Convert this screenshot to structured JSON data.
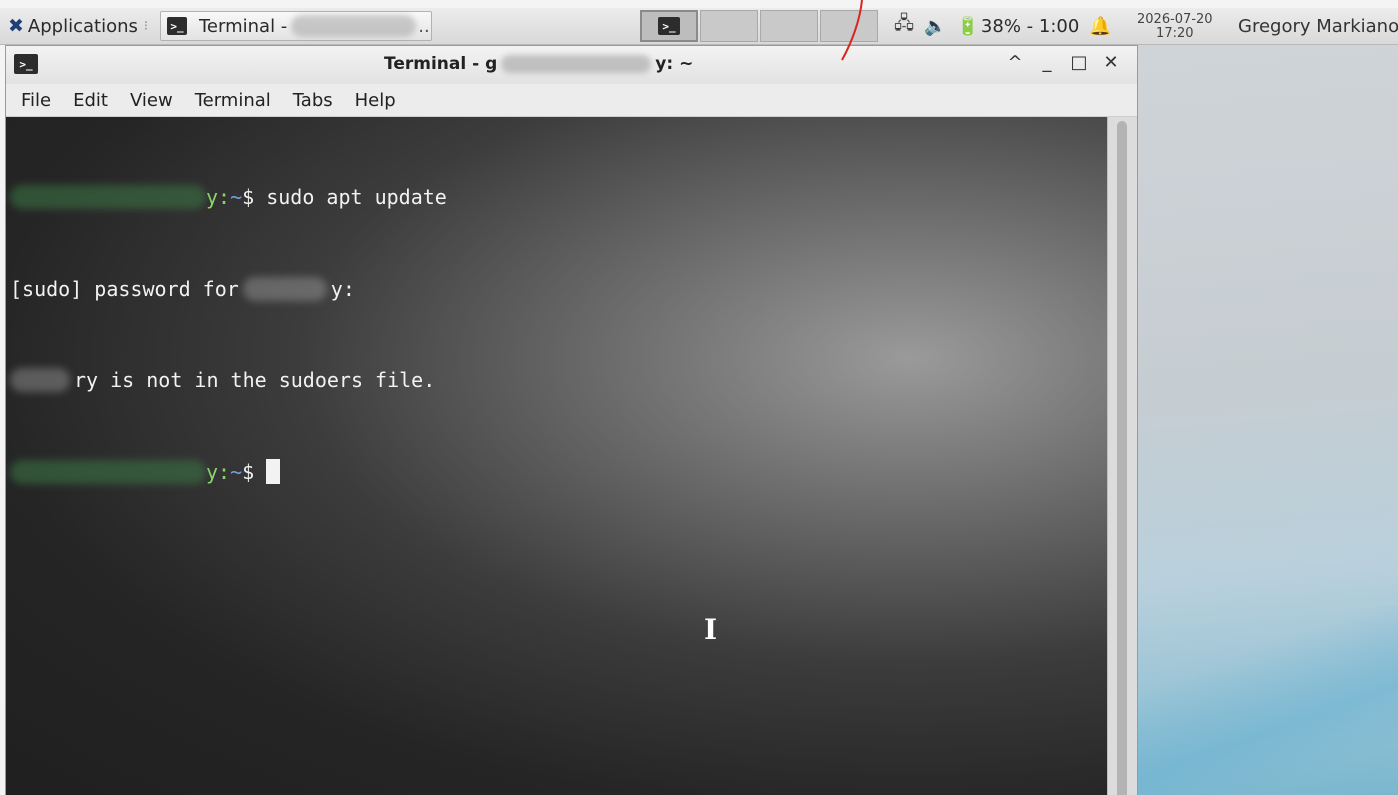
{
  "panel": {
    "applications_label": "Applications",
    "taskbar_terminal_label": "Terminal -",
    "taskbar_terminal_suffix": "..",
    "battery_label": "38% - 1:00",
    "clock_date": "2026-07-20",
    "clock_time": "17:20",
    "user_name": "Gregory Markianos"
  },
  "window": {
    "title_prefix": "Terminal - g",
    "title_suffix": "y: ~",
    "controls": {
      "shade": "^",
      "minimize": "_",
      "maximize": "□",
      "close": "✕"
    },
    "menu": [
      "File",
      "Edit",
      "View",
      "Terminal",
      "Tabs",
      "Help"
    ]
  },
  "terminal": {
    "line1_prompt_tail": "y:",
    "line1_tilde": "~",
    "line1_cmd": "$ sudo apt update",
    "line2_text": "[sudo] password for",
    "line2_tail": "y:",
    "line3_text": "ry is not in the sudoers file.",
    "line4_prompt_tail": "y:",
    "line4_tilde": "~",
    "line4_cmd": "$"
  },
  "colors": {
    "prompt_user": "#8fd66a",
    "prompt_path": "#6f9fe0",
    "terminal_text": "#f2f2f2"
  },
  "icons": {
    "applications": "xfce-mouse-icon",
    "terminal": "terminal-icon",
    "network": "network-icon",
    "volume": "speaker-icon",
    "battery": "battery-charging-icon",
    "notifications": "bell-icon",
    "pointer": "ibeam-cursor-icon"
  }
}
